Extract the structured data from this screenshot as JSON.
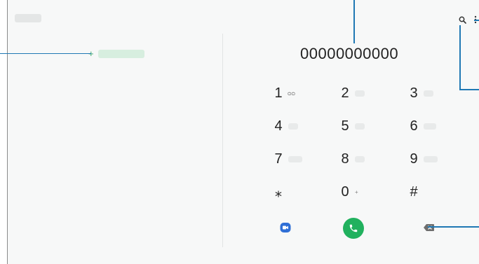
{
  "dialer": {
    "number": "00000000000",
    "keys": [
      {
        "digit": "1",
        "sub": "ᴑᴑ"
      },
      {
        "digit": "2",
        "sub": ""
      },
      {
        "digit": "3",
        "sub": ""
      },
      {
        "digit": "4",
        "sub": ""
      },
      {
        "digit": "5",
        "sub": ""
      },
      {
        "digit": "6",
        "sub": ""
      },
      {
        "digit": "7",
        "sub": ""
      },
      {
        "digit": "8",
        "sub": ""
      },
      {
        "digit": "9",
        "sub": ""
      },
      {
        "digit": "⁎",
        "sub": ""
      },
      {
        "digit": "0",
        "sub": "+"
      },
      {
        "digit": "#",
        "sub": ""
      }
    ]
  },
  "add_contact": {
    "icon": "+"
  },
  "toolbar": {
    "search_icon": "search-icon",
    "more_icon": "more-options-icon"
  },
  "actions": {
    "video_icon": "video-call-icon",
    "call_icon": "phone-icon",
    "backspace_icon": "backspace-icon"
  },
  "colors": {
    "accent_green": "#21b15e",
    "video_blue": "#2f6fd6",
    "callout_blue": "#1f78b4",
    "background": "#f7f8f8"
  }
}
